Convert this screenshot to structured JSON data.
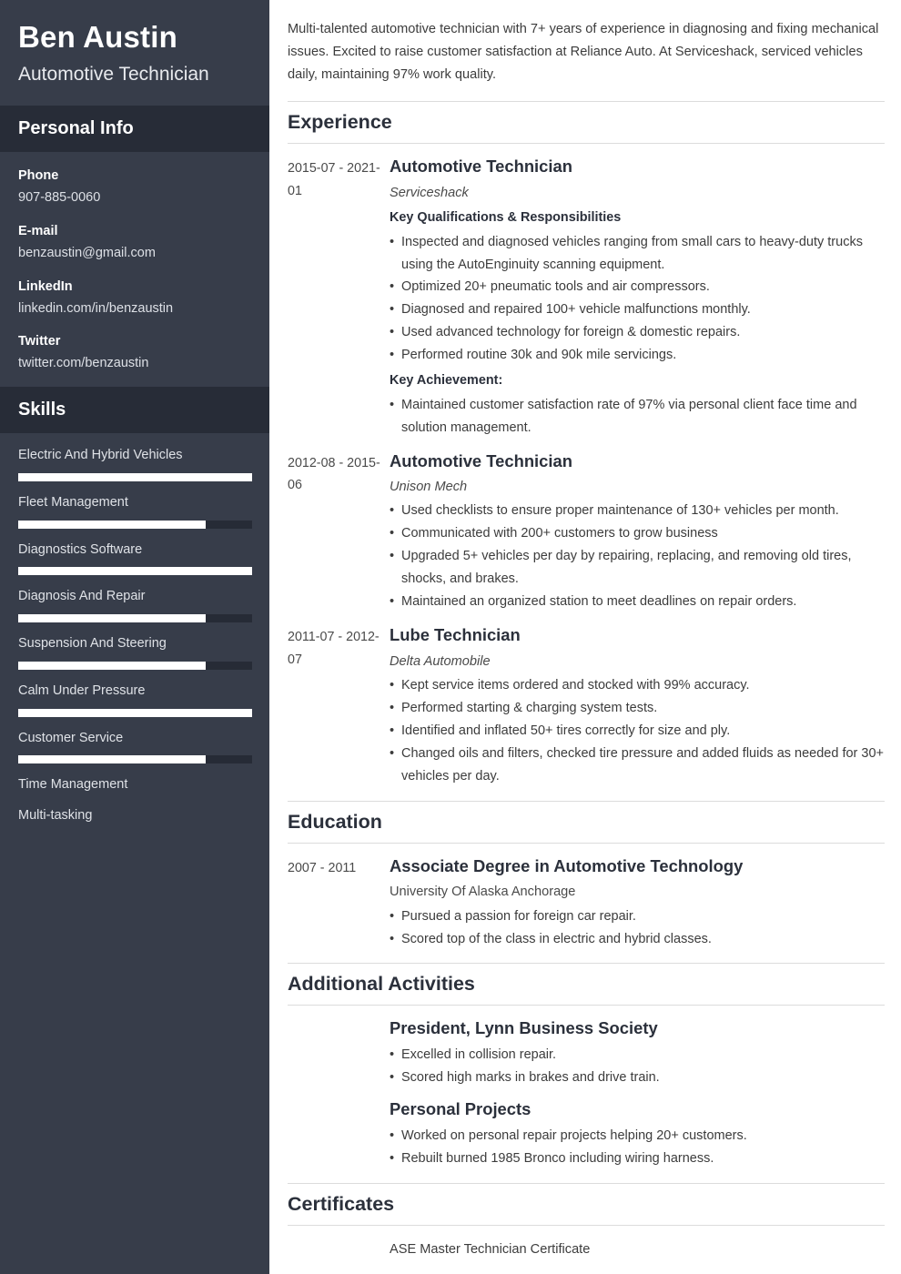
{
  "sidebar": {
    "name": "Ben Austin",
    "job_title": "Automotive Technician",
    "personal_info": {
      "heading": "Personal Info",
      "items": [
        {
          "label": "Phone",
          "value": "907-885-0060"
        },
        {
          "label": "E-mail",
          "value": "benzaustin@gmail.com"
        },
        {
          "label": "LinkedIn",
          "value": "linkedin.com/in/benzaustin"
        },
        {
          "label": "Twitter",
          "value": "twitter.com/benzaustin"
        }
      ]
    },
    "skills": {
      "heading": "Skills",
      "items": [
        {
          "name": "Electric And Hybrid Vehicles",
          "level": 100,
          "has_bar": true
        },
        {
          "name": "Fleet Management",
          "level": 80,
          "has_bar": true
        },
        {
          "name": "Diagnostics Software",
          "level": 100,
          "has_bar": true
        },
        {
          "name": "Diagnosis And Repair",
          "level": 80,
          "has_bar": true
        },
        {
          "name": "Suspension And Steering",
          "level": 80,
          "has_bar": true
        },
        {
          "name": "Calm Under Pressure",
          "level": 100,
          "has_bar": true
        },
        {
          "name": "Customer Service",
          "level": 80,
          "has_bar": true
        },
        {
          "name": "Time Management",
          "level": 0,
          "has_bar": false
        },
        {
          "name": "Multi-tasking",
          "level": 0,
          "has_bar": false
        }
      ]
    },
    "colors": {
      "background": "#373d4a",
      "header_band": "#272c37",
      "bar_track": "#262b36",
      "bar_fill": "#ffffff"
    }
  },
  "main": {
    "summary": "Multi-talented automotive technician with 7+ years of experience in diagnosing and fixing mechanical issues. Excited to raise customer satisfaction at Reliance Auto. At Serviceshack, serviced vehicles daily, maintaining 97% work quality.",
    "experience": {
      "heading": "Experience",
      "entries": [
        {
          "dates": "2015-07 - 2021-01",
          "role": "Automotive Technician",
          "org": "Serviceshack",
          "qual_heading": "Key Qualifications & Responsibilities",
          "bullets": [
            "Inspected and diagnosed vehicles ranging from small cars to heavy-duty trucks using the AutoEnginuity scanning equipment.",
            "Optimized 20+ pneumatic tools and air compressors.",
            "Diagnosed and repaired 100+ vehicle malfunctions monthly.",
            "Used advanced technology for foreign & domestic repairs.",
            "Performed routine 30k and 90k mile servicings."
          ],
          "achievement_heading": "Key Achievement:",
          "achievement_bullets": [
            "Maintained customer satisfaction rate of 97% via personal client face time and solution management."
          ]
        },
        {
          "dates": "2012-08 - 2015-06",
          "role": "Automotive Technician",
          "org": "Unison Mech",
          "qual_heading": "",
          "bullets": [
            "Used checklists to ensure proper maintenance of 130+ vehicles per month.",
            "Communicated with 200+ customers to grow business",
            "Upgraded 5+ vehicles per day by repairing, replacing, and removing old tires, shocks, and brakes.",
            "Maintained an organized station to meet deadlines on repair orders."
          ],
          "achievement_heading": "",
          "achievement_bullets": []
        },
        {
          "dates": "2011-07 - 2012-07",
          "role": "Lube Technician",
          "org": "Delta Automobile",
          "qual_heading": "",
          "bullets": [
            "Kept service items ordered and stocked with 99% accuracy.",
            "Performed starting & charging system tests.",
            "Identified and inflated 50+ tires correctly for size and ply.",
            "Changed oils and filters, checked tire pressure and added fluids as needed for 30+ vehicles per day."
          ],
          "achievement_heading": "",
          "achievement_bullets": []
        }
      ]
    },
    "education": {
      "heading": "Education",
      "entries": [
        {
          "dates": "2007 - 2011",
          "degree": "Associate Degree in Automotive Technology",
          "school": "University Of Alaska Anchorage",
          "bullets": [
            "Pursued a passion for foreign car repair.",
            "Scored top of the class in electric and hybrid classes."
          ]
        }
      ]
    },
    "additional_activities": {
      "heading": "Additional Activities",
      "groups": [
        {
          "title": "President, Lynn Business Society",
          "bullets": [
            "Excelled in collision repair.",
            "Scored high marks in brakes and drive train."
          ]
        },
        {
          "title": "Personal Projects",
          "bullets": [
            "Worked on personal repair projects helping 20+ customers.",
            "Rebuilt burned 1985 Bronco including wiring harness."
          ]
        }
      ]
    },
    "certificates": {
      "heading": "Certificates",
      "items": [
        "ASE Master Technician Certificate"
      ]
    }
  }
}
